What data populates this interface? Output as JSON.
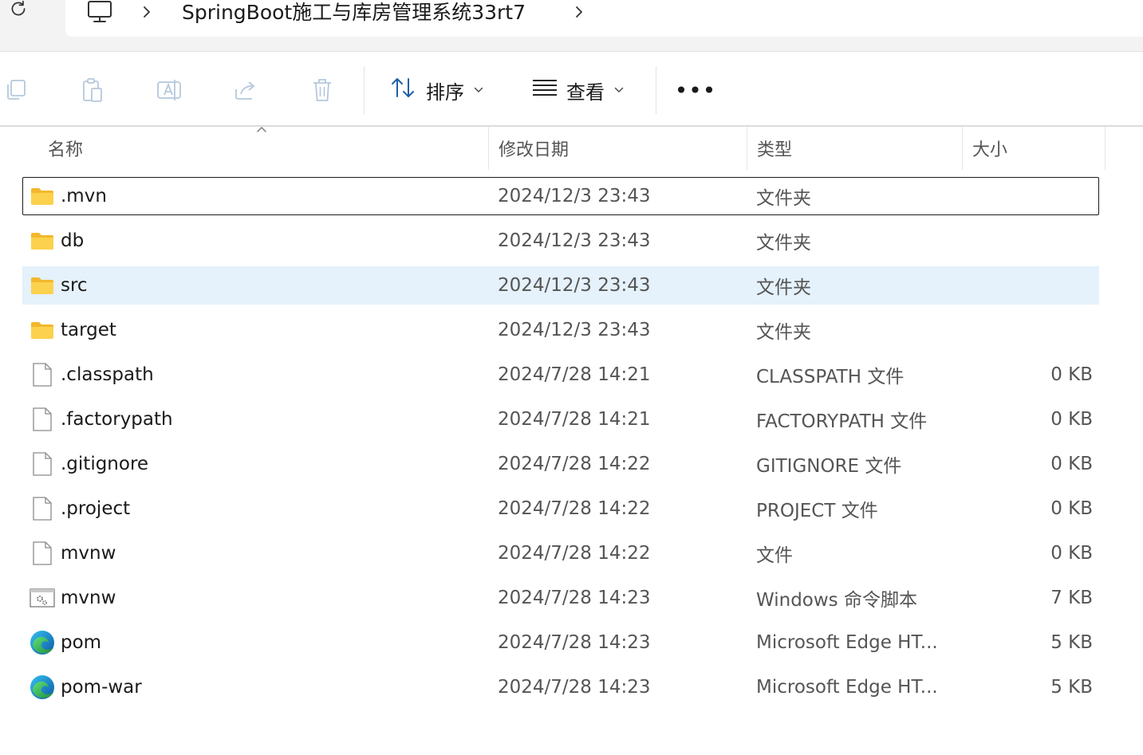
{
  "address_bar": {
    "path_segments": [
      "SpringBoot施工与库房管理系统33rt7"
    ]
  },
  "toolbar": {
    "sort_label": "排序",
    "view_label": "查看",
    "more_label": "•••"
  },
  "columns": {
    "name": "名称",
    "date": "修改日期",
    "type": "类型",
    "size": "大小"
  },
  "files": [
    {
      "name": ".mvn",
      "date": "2024/12/3 23:43",
      "type": "文件夹",
      "size": "",
      "icon": "folder-icon"
    },
    {
      "name": "db",
      "date": "2024/12/3 23:43",
      "type": "文件夹",
      "size": "",
      "icon": "folder-icon"
    },
    {
      "name": "src",
      "date": "2024/12/3 23:43",
      "type": "文件夹",
      "size": "",
      "icon": "folder-icon"
    },
    {
      "name": "target",
      "date": "2024/12/3 23:43",
      "type": "文件夹",
      "size": "",
      "icon": "folder-icon"
    },
    {
      "name": ".classpath",
      "date": "2024/7/28 14:21",
      "type": "CLASSPATH 文件",
      "size": "0 KB",
      "icon": "file-icon"
    },
    {
      "name": ".factorypath",
      "date": "2024/7/28 14:21",
      "type": "FACTORYPATH 文件",
      "size": "0 KB",
      "icon": "file-icon"
    },
    {
      "name": ".gitignore",
      "date": "2024/7/28 14:22",
      "type": "GITIGNORE 文件",
      "size": "0 KB",
      "icon": "file-icon"
    },
    {
      "name": ".project",
      "date": "2024/7/28 14:22",
      "type": "PROJECT 文件",
      "size": "0 KB",
      "icon": "file-icon"
    },
    {
      "name": "mvnw",
      "date": "2024/7/28 14:22",
      "type": "文件",
      "size": "0 KB",
      "icon": "file-icon"
    },
    {
      "name": "mvnw",
      "date": "2024/7/28 14:23",
      "type": "Windows 命令脚本",
      "size": "7 KB",
      "icon": "script-icon"
    },
    {
      "name": "pom",
      "date": "2024/7/28 14:23",
      "type": "Microsoft Edge HT...",
      "size": "5 KB",
      "icon": "edge-icon"
    },
    {
      "name": "pom-war",
      "date": "2024/7/28 14:23",
      "type": "Microsoft Edge HT...",
      "size": "5 KB",
      "icon": "edge-icon"
    }
  ],
  "state": {
    "focused_row": ".mvn",
    "selected_row": "src"
  },
  "colors": {
    "selection": "#e5f1fb",
    "folder": "#f8c542",
    "accent": "#0a64c8"
  }
}
